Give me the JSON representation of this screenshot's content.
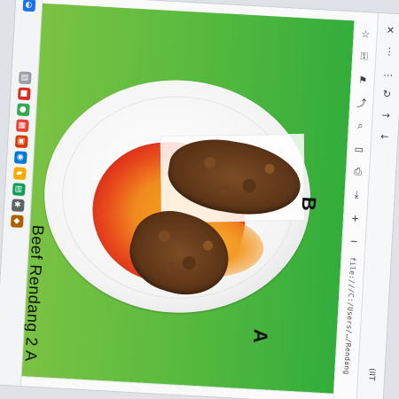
{
  "taskbar": {
    "icons": [
      {
        "name": "browser-icon",
        "color": "#1a73e8",
        "glyph": "◐"
      },
      {
        "name": "file-icon",
        "color": "#9aa0a6",
        "glyph": "▤"
      },
      {
        "name": "red-app-icon",
        "color": "#d93025",
        "glyph": "■"
      },
      {
        "name": "chrome-icon",
        "color": "#34a853",
        "glyph": "●"
      },
      {
        "name": "calendar-icon",
        "color": "#ea4335",
        "glyph": "▦"
      },
      {
        "name": "office-icon",
        "color": "#d83b01",
        "glyph": "▣"
      },
      {
        "name": "edge-icon",
        "color": "#0078d4",
        "glyph": "◉"
      },
      {
        "name": "folder-icon",
        "color": "#f9ab00",
        "glyph": "▰"
      },
      {
        "name": "store-icon",
        "color": "#0f9d58",
        "glyph": "▥"
      },
      {
        "name": "settings-icon",
        "color": "#5f6368",
        "glyph": "✱"
      },
      {
        "name": "app-icon-dark",
        "color": "#b06000",
        "glyph": "◆"
      }
    ]
  },
  "caption": {
    "text": "Beef Rendang 2 A"
  },
  "plate": {
    "label_a": "A",
    "label_b": "B"
  },
  "toolbar": {
    "url_text": "file:///C:/Users/…/Rendang",
    "status_text": "(IIT",
    "glyphs": {
      "close": "✕",
      "back": "←",
      "forward": "→",
      "refresh": "↻",
      "zoom_in": "+",
      "zoom_out": "−",
      "print": "⎙",
      "page": "▭",
      "search": "⌕",
      "menu": "⋮",
      "star": "☆",
      "lock": "⚿",
      "bookmark": "⚑",
      "share": "⤴",
      "download": "⤓",
      "more": "…"
    }
  }
}
